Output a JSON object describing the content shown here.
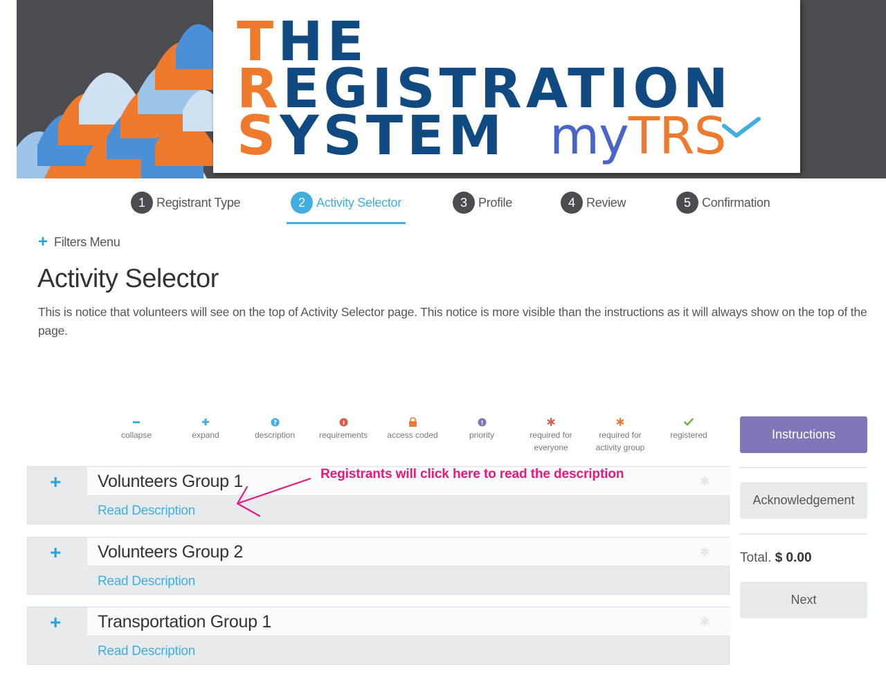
{
  "banner": {
    "logo_line1_first": "T",
    "logo_line1_rest": "HE",
    "logo_line2_first": "R",
    "logo_line2_rest": "EGISTRATION",
    "logo_line3_first": "S",
    "logo_line3_rest": "YSTEM",
    "mytrs_my": "my",
    "mytrs_trs": "TRS",
    "brand_orange": "#ee7a2d",
    "brand_blue": "#104a80"
  },
  "steps": [
    {
      "num": "1",
      "label": "Registrant Type",
      "active": false
    },
    {
      "num": "2",
      "label": "Activity Selector",
      "active": true
    },
    {
      "num": "3",
      "label": "Profile",
      "active": false
    },
    {
      "num": "4",
      "label": "Review",
      "active": false
    },
    {
      "num": "5",
      "label": "Confirmation",
      "active": false
    }
  ],
  "filters": {
    "icon": "plus-icon",
    "label": "Filters Menu"
  },
  "page": {
    "title": "Activity Selector",
    "notice": "This is notice that volunteers will see on the top of Activity Selector page. This notice is more visible than the instructions as it will always show on the top of the page."
  },
  "legend": [
    {
      "icon": "minus-icon",
      "label": "collapse",
      "color": "#41aee0"
    },
    {
      "icon": "plus-icon",
      "label": "expand",
      "color": "#41aee0"
    },
    {
      "icon": "question-circle-icon",
      "label": "description",
      "color": "#41aee0"
    },
    {
      "icon": "info-circle-icon",
      "label": "requirements",
      "color": "#e05a4a"
    },
    {
      "icon": "lock-icon",
      "label": "access coded",
      "color": "#ee7a2d"
    },
    {
      "icon": "exclamation-circle-icon",
      "label": "priority",
      "color": "#7e77b8"
    },
    {
      "icon": "asterisk-icon",
      "label": "required for everyone",
      "color": "#e05a4a"
    },
    {
      "icon": "asterisk-icon",
      "label": "required for activity group",
      "color": "#ee7a2d"
    },
    {
      "icon": "check-icon",
      "label": "registered",
      "color": "#6cb33f"
    }
  ],
  "groups": [
    {
      "title": "Volunteers Group 1",
      "link": "Read Description"
    },
    {
      "title": "Volunteers Group 2",
      "link": "Read Description"
    },
    {
      "title": "Transportation Group 1",
      "link": "Read Description"
    }
  ],
  "annotation": {
    "text": "Registrants will click here to read the description",
    "color": "#e8197d"
  },
  "sidebar": {
    "instructions": "Instructions",
    "acknowledgement": "Acknowledgement",
    "total_label": "Total.",
    "total_amount": "$ 0.00",
    "next": "Next",
    "accent": "#7e77b8"
  }
}
